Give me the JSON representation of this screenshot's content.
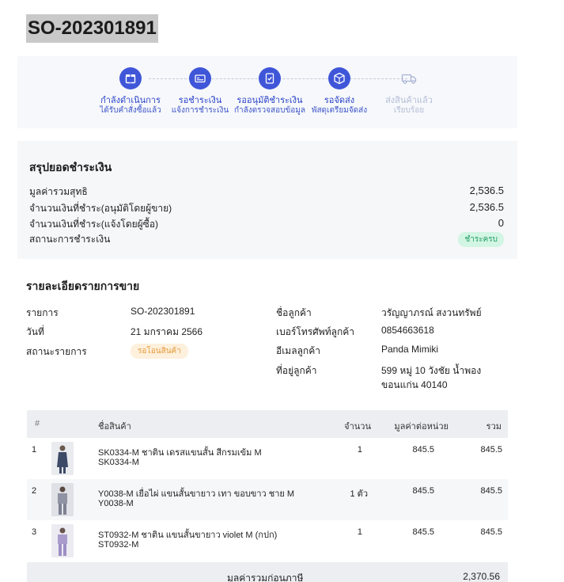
{
  "order": {
    "number": "SO-202301891"
  },
  "steps": [
    {
      "title": "กำลังดำเนินการ",
      "subtitle": "ได้รับคำสั่งซื้อแล้ว",
      "icon": "box-icon",
      "active": true
    },
    {
      "title": "รอชำระเงิน",
      "subtitle": "แจ้งการชำระเงิน",
      "icon": "payment-card-icon",
      "active": true
    },
    {
      "title": "รออนุมัติชำระเงิน",
      "subtitle": "กำลังตรวจสอบข้อมูล",
      "icon": "document-check-icon",
      "active": true
    },
    {
      "title": "รอจัดส่ง",
      "subtitle": "พัสดุเตรียมจัดส่ง",
      "icon": "package-icon",
      "active": true
    },
    {
      "title": "ส่งสินค้าแล้ว",
      "subtitle": "เรียบร้อย",
      "icon": "truck-icon",
      "active": false
    }
  ],
  "payment_summary": {
    "heading": "สรุปยอดชำระเงิน",
    "rows": [
      {
        "label": "มูลค่ารวมสุทธิ",
        "value": "2,536.5"
      },
      {
        "label": "จำนวนเงินที่ชำระ(อนุมัติโดยผู้ขาย)",
        "value": "2,536.5"
      },
      {
        "label": "จำนวนเงินที่ชำระ(แจ้งโดยผู้ซื้อ)",
        "value": "0"
      },
      {
        "label": "สถานะการชำระเงิน",
        "value": "ชำระครบ"
      }
    ]
  },
  "sale_details": {
    "heading": "รายละเอียดรายการขาย",
    "left": [
      {
        "label": "รายการ",
        "value": "SO-202301891"
      },
      {
        "label": "วันที่",
        "value": "21 มกราคม 2566"
      },
      {
        "label": "สถานะรายการ",
        "value": "รอโอนสินค้า"
      }
    ],
    "right": [
      {
        "label": "ชื่อลูกค้า",
        "value": "วรัญญาภรณ์ สงวนทรัพย์"
      },
      {
        "label": "เบอร์โทรศัพท์ลูกค้า",
        "value": "0854663618"
      },
      {
        "label": "อีเมลลูกค้า",
        "value": "Panda Mimiki"
      },
      {
        "label": "ที่อยู่ลูกค้า",
        "value": "599 หมู่ 10 วังชัย น้ำพอง",
        "value_line2": "ขอนแก่น 40140"
      }
    ]
  },
  "items_table": {
    "headers": {
      "no": "#",
      "name": "ชื่อสินค้า",
      "qty": "จำนวน",
      "unit_price": "มูลค่าต่อหน่วย",
      "total": "รวม"
    },
    "rows": [
      {
        "no": "1",
        "name": "SK0334-M ชาติน เดรสแขนสั้น สีกรมเข้ม M",
        "sku": "SK0334-M",
        "qty": "1",
        "unit_price": "845.5",
        "total": "845.5",
        "thumb_color": "#3d4a66"
      },
      {
        "no": "2",
        "name": "Y0038-M เยื่อไผ่ แขนสั้นขายาว เทา ขอบขาว ชาย M",
        "sku": "Y0038-M",
        "qty": "1 ตัว",
        "unit_price": "845.5",
        "total": "845.5",
        "thumb_color": "#8f93a3"
      },
      {
        "no": "3",
        "name": "ST0932-M ชาติน แขนสั้นขายาว violet M (กปก)",
        "sku": "ST0932-M",
        "qty": "1",
        "unit_price": "845.5",
        "total": "845.5",
        "thumb_color": "#9d8fc4"
      }
    ],
    "subtotal_label": "มูลค่ารวมก่อนภาษี",
    "subtotal_value": "2,370.56"
  }
}
